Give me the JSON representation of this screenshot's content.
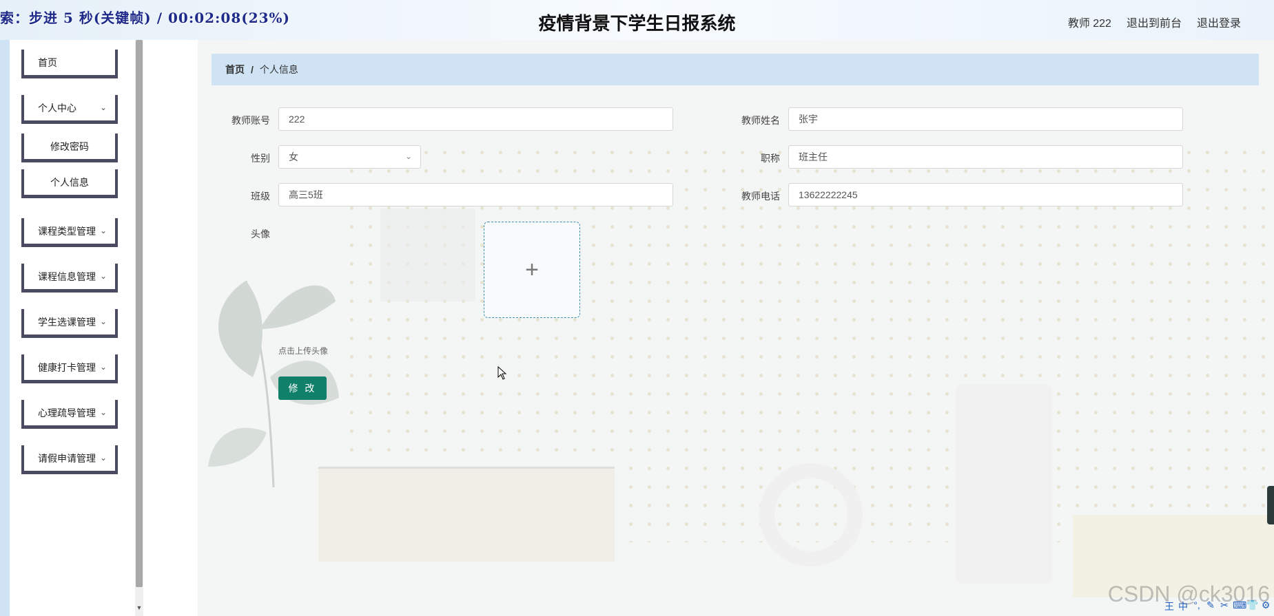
{
  "overlay_text": "索：步进 5 秒(关键帧) / 00:02:08(23%)",
  "header": {
    "title": "疫情背景下学生日报系统",
    "user": "教师 222",
    "to_front": "退出到前台",
    "logout": "退出登录"
  },
  "sidebar": {
    "home": "首页",
    "personal_center": "个人中心",
    "change_password": "修改密码",
    "personal_info": "个人信息",
    "course_type_mgmt": "课程类型管理",
    "course_info_mgmt": "课程信息管理",
    "student_course_mgmt": "学生选课管理",
    "health_checkin_mgmt": "健康打卡管理",
    "counseling_mgmt": "心理疏导管理",
    "leave_mgmt": "请假申请管理"
  },
  "breadcrumb": {
    "home": "首页",
    "separator": "/",
    "current": "个人信息"
  },
  "form": {
    "account_label": "教师账号",
    "account_value": "222",
    "name_label": "教师姓名",
    "name_value": "张宇",
    "gender_label": "性别",
    "gender_value": "女",
    "title_label": "职称",
    "title_value": "班主任",
    "class_label": "班级",
    "class_value": "高三5班",
    "phone_label": "教师电话",
    "phone_value": "13622222245",
    "avatar_label": "头像",
    "upload_icon": "+",
    "upload_tip": "点击上传头像",
    "submit": "修 改"
  },
  "watermark": "CSDN @ck3016",
  "ime_toolbar": [
    "王",
    "中",
    "°,",
    "✎",
    "✂",
    "⌨",
    "👕",
    "⚙"
  ],
  "colors": {
    "accent_button": "#11806a",
    "breadcrumb_bg": "#cfe3f4",
    "menu_border": "#4a4a63"
  }
}
